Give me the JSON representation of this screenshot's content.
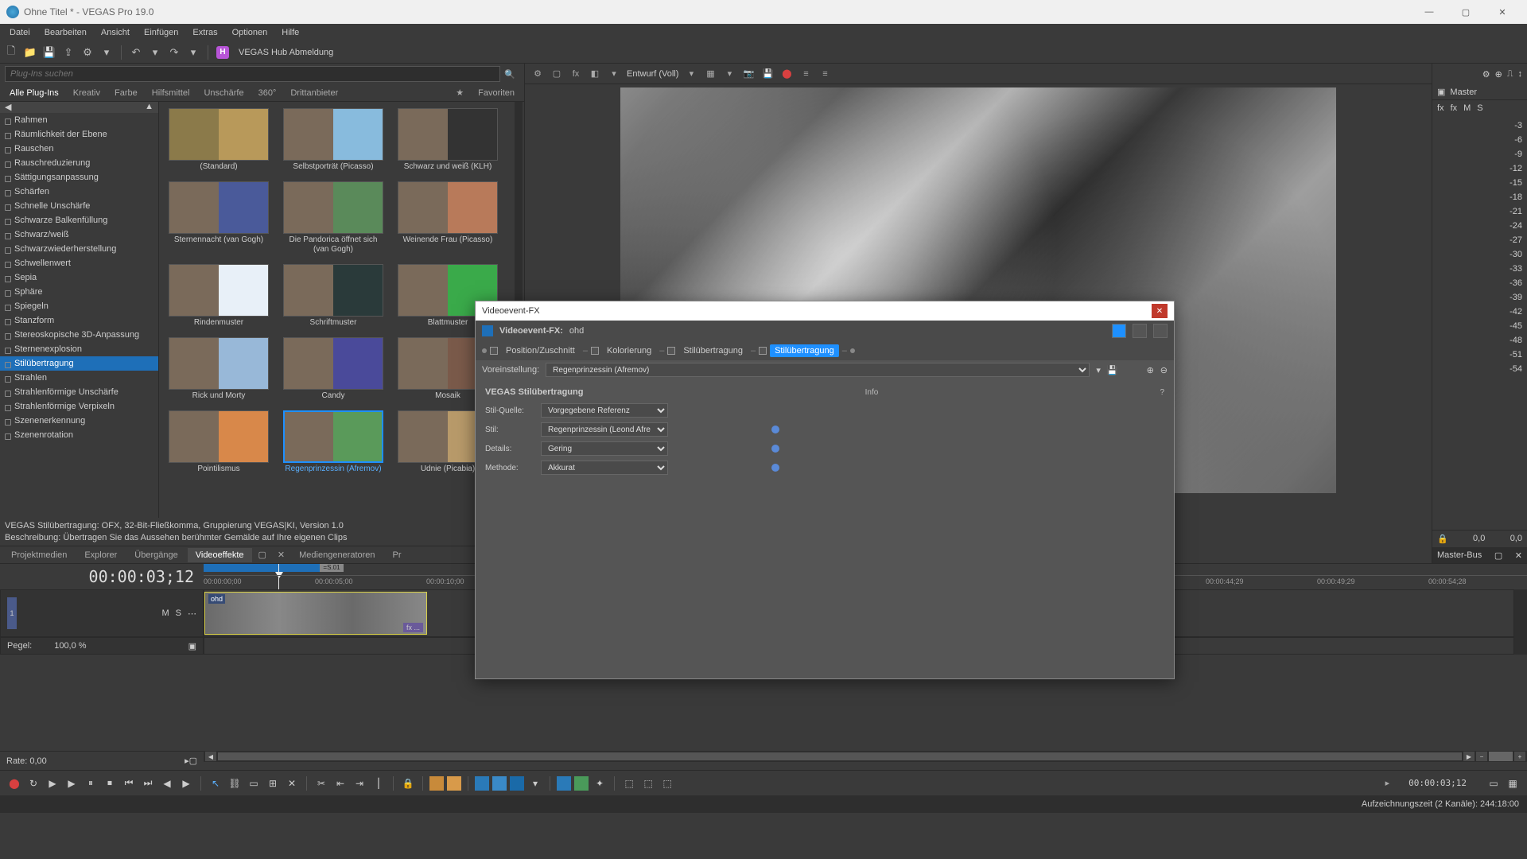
{
  "window": {
    "title": "Ohne Titel * - VEGAS Pro 19.0"
  },
  "menu": [
    "Datei",
    "Bearbeiten",
    "Ansicht",
    "Einfügen",
    "Extras",
    "Optionen",
    "Hilfe"
  ],
  "hub": "VEGAS Hub Abmeldung",
  "search": {
    "placeholder": "Plug-Ins suchen"
  },
  "plugin_tabs": [
    "Alle Plug-Ins",
    "Kreativ",
    "Farbe",
    "Hilfsmittel",
    "Unschärfe",
    "360°",
    "Drittanbieter"
  ],
  "fav": "Favoriten",
  "plugins": [
    "Rahmen",
    "Räumlichkeit der Ebene",
    "Rauschen",
    "Rauschreduzierung",
    "Sättigungsanpassung",
    "Schärfen",
    "Schnelle Unschärfe",
    "Schwarze Balkenfüllung",
    "Schwarz/weiß",
    "Schwarzwiederherstellung",
    "Schwellenwert",
    "Sepia",
    "Sphäre",
    "Spiegeln",
    "Stanzform",
    "Stereoskopische 3D-Anpassung",
    "Sternenexplosion",
    "Stilübertragung",
    "Strahlen",
    "Strahlenförmige Unschärfe",
    "Strahlenförmige Verpixeln",
    "Szenenerkennung",
    "Szenenrotation"
  ],
  "selected_plugin": "Stilübertragung",
  "presets": [
    {
      "name": "(Standard)",
      "cls": "t1"
    },
    {
      "name": "Selbstporträt (Picasso)",
      "cls": "t2"
    },
    {
      "name": "Schwarz und weiß (KLH)",
      "cls": "t3"
    },
    {
      "name": "Sternennacht (van Gogh)",
      "cls": "t4"
    },
    {
      "name": "Die Pandorica öffnet sich (van Gogh)",
      "cls": "t5"
    },
    {
      "name": "Weinende Frau (Picasso)",
      "cls": "t6"
    },
    {
      "name": "Rindenmuster",
      "cls": "t7"
    },
    {
      "name": "Schriftmuster",
      "cls": "t8"
    },
    {
      "name": "Blattmuster",
      "cls": "t9"
    },
    {
      "name": "Rick und Morty",
      "cls": "t10"
    },
    {
      "name": "Candy",
      "cls": "t11"
    },
    {
      "name": "Mosaik",
      "cls": "t12"
    },
    {
      "name": "Pointilismus",
      "cls": "t13"
    },
    {
      "name": "Regenprinzessin (Afremov)",
      "cls": "t14",
      "selected": true
    },
    {
      "name": "Udnie (Picabia)",
      "cls": "t15"
    }
  ],
  "info1": "VEGAS Stilübertragung: OFX, 32-Bit-Fließkomma, Gruppierung VEGAS|KI, Version 1.0",
  "info2": "Beschreibung: Übertragen Sie das Aussehen berühmter Gemälde auf Ihre eigenen Clips",
  "btabs": [
    "Projektmedien",
    "Explorer",
    "Übergänge",
    "Videoeffekte",
    "Mediengeneratoren",
    "Pr"
  ],
  "btab_active": "Videoeffekte",
  "preview": {
    "mode": "Entwurf (Voll)"
  },
  "fx": {
    "title": "Videoevent-FX",
    "bread": "Videoevent-FX:",
    "clip": "ohd",
    "chain": [
      "Position/Zuschnitt",
      "Kolorierung",
      "Stilübertragung",
      "Stilübertragung"
    ],
    "chain_active": 3,
    "preset_label": "Voreinstellung:",
    "preset": "Regenprinzessin (Afremov)",
    "heading": "VEGAS Stilübertragung",
    "info": "Info",
    "q": "?",
    "rows": [
      {
        "label": "Stil-Quelle:",
        "value": "Vorgegebene Referenz",
        "kf": false
      },
      {
        "label": "Stil:",
        "value": "Regenprinzessin (Leond Afre",
        "kf": true
      },
      {
        "label": "Details:",
        "value": "Gering",
        "kf": true
      },
      {
        "label": "Methode:",
        "value": "Akkurat",
        "kf": true
      }
    ]
  },
  "master": {
    "title": "Master",
    "fx": [
      "fx",
      "fx",
      "M",
      "S"
    ],
    "db": [
      "-3",
      "-6",
      "-9",
      "-12",
      "-15",
      "-18",
      "-21",
      "-24",
      "-27",
      "-30",
      "-33",
      "-36",
      "-39",
      "-42",
      "-45",
      "-48",
      "-51",
      "-54"
    ],
    "foot_l": "0,0",
    "foot_r": "0,0",
    "bus": "Master-Bus"
  },
  "timeline": {
    "tc": "00:00:03;12",
    "ticks": [
      "00:00:00;00",
      "00:00:05;00",
      "00:00:10;00",
      "00:00:44;29",
      "00:00:49;29",
      "00:00:54;28"
    ],
    "marker": "=S.01",
    "track": {
      "ms": [
        "M",
        "S"
      ],
      "level_label": "Pegel:",
      "level": "100,0 %",
      "clip": "ohd",
      "fx": "fx ..."
    }
  },
  "status": {
    "rate": "Rate: 0,00",
    "tc": "00:00:03;12"
  },
  "footer": "Aufzeichnungszeit (2 Kanäle): 244:18:00"
}
